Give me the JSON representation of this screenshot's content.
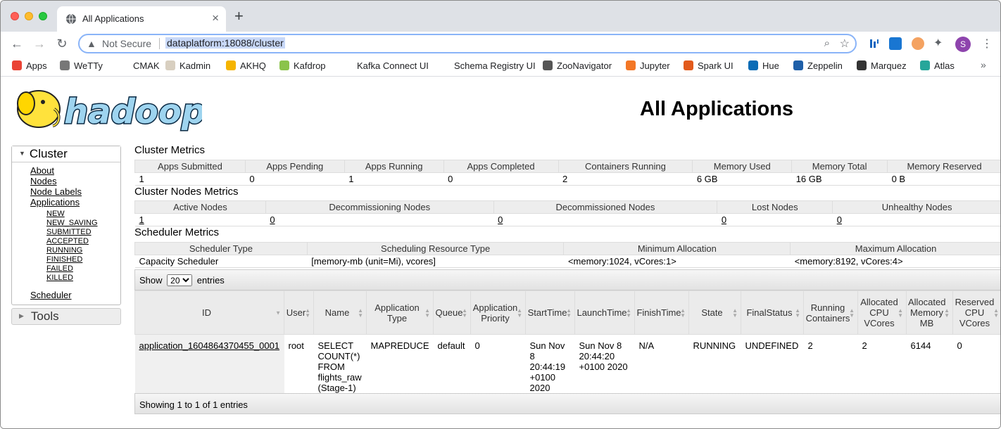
{
  "browser": {
    "tab_title": "All Applications",
    "tab_close": "×",
    "new_tab": "+",
    "security_label": "Not Secure",
    "url": "dataplatform:18088/cluster",
    "avatar_letter": "S",
    "bookmarks": [
      {
        "label": "Apps",
        "color": "#ea4335"
      },
      {
        "label": "WeTTy",
        "color": "#777777"
      },
      {
        "label": "CMAK",
        "color": "#ffffff"
      },
      {
        "label": "Kadmin",
        "color": "#d8cfc0"
      },
      {
        "label": "AKHQ",
        "color": "#f5b400"
      },
      {
        "label": "Kafdrop",
        "color": "#8bc34a"
      },
      {
        "label": "Kafka Connect UI",
        "color": "#ffffff"
      },
      {
        "label": "Schema Registry UI",
        "color": "#ffffff"
      },
      {
        "label": "ZooNavigator",
        "color": "#555555"
      },
      {
        "label": "Jupyter",
        "color": "#f37726"
      },
      {
        "label": "Spark UI",
        "color": "#e25a1c"
      },
      {
        "label": "Hue",
        "color": "#0b6cb6"
      },
      {
        "label": "Zeppelin",
        "color": "#1e5fa8"
      },
      {
        "label": "Marquez",
        "color": "#333333"
      },
      {
        "label": "Atlas",
        "color": "#26a69a"
      }
    ],
    "bookmarks_more": "»"
  },
  "page": {
    "title": "All Applications",
    "logo_text": "hadoop"
  },
  "nav": {
    "cluster_header": "Cluster",
    "links": [
      "About",
      "Nodes",
      "Node Labels",
      "Applications"
    ],
    "app_states": [
      "NEW",
      "NEW_SAVING",
      "SUBMITTED",
      "ACCEPTED",
      "RUNNING",
      "FINISHED",
      "FAILED",
      "KILLED"
    ],
    "scheduler": "Scheduler",
    "tools_header": "Tools"
  },
  "cluster_metrics": {
    "title": "Cluster Metrics",
    "headers": [
      "Apps Submitted",
      "Apps Pending",
      "Apps Running",
      "Apps Completed",
      "Containers Running",
      "Memory Used",
      "Memory Total",
      "Memory Reserved"
    ],
    "values": [
      "1",
      "0",
      "1",
      "0",
      "2",
      "6 GB",
      "16 GB",
      "0 B"
    ]
  },
  "node_metrics": {
    "title": "Cluster Nodes Metrics",
    "headers": [
      "Active Nodes",
      "Decommissioning Nodes",
      "Decommissioned Nodes",
      "Lost Nodes",
      "Unhealthy Nodes"
    ],
    "values": [
      "1",
      "0",
      "0",
      "0",
      "0"
    ]
  },
  "scheduler_metrics": {
    "title": "Scheduler Metrics",
    "headers": [
      "Scheduler Type",
      "Scheduling Resource Type",
      "Minimum Allocation",
      "Maximum Allocation"
    ],
    "values": [
      "Capacity Scheduler",
      "[memory-mb (unit=Mi), vcores]",
      "<memory:1024, vCores:1>",
      "<memory:8192, vCores:4>"
    ]
  },
  "apps_table": {
    "show_label": "Show",
    "entries_label": "entries",
    "page_size": "20",
    "headers": [
      "ID",
      "User",
      "Name",
      "Application Type",
      "Queue",
      "Application Priority",
      "StartTime",
      "LaunchTime",
      "FinishTime",
      "State",
      "FinalStatus",
      "Running Containers",
      "Allocated CPU VCores",
      "Allocated Memory MB",
      "Reserved CPU VCores"
    ],
    "row": {
      "id": "application_1604864370455_0001",
      "user": "root",
      "name": "SELECT COUNT(*) FROM flights_raw (Stage-1)",
      "type": "MAPREDUCE",
      "queue": "default",
      "priority": "0",
      "start": "Sun Nov 8 20:44:19 +0100 2020",
      "launch": "Sun Nov 8 20:44:20 +0100 2020",
      "finish": "N/A",
      "state": "RUNNING",
      "final_status": "UNDEFINED",
      "running_containers": "2",
      "alloc_vcores": "2",
      "alloc_mem": "6144",
      "reserved_vcores": "0"
    },
    "footer": "Showing 1 to 1 of 1 entries"
  }
}
